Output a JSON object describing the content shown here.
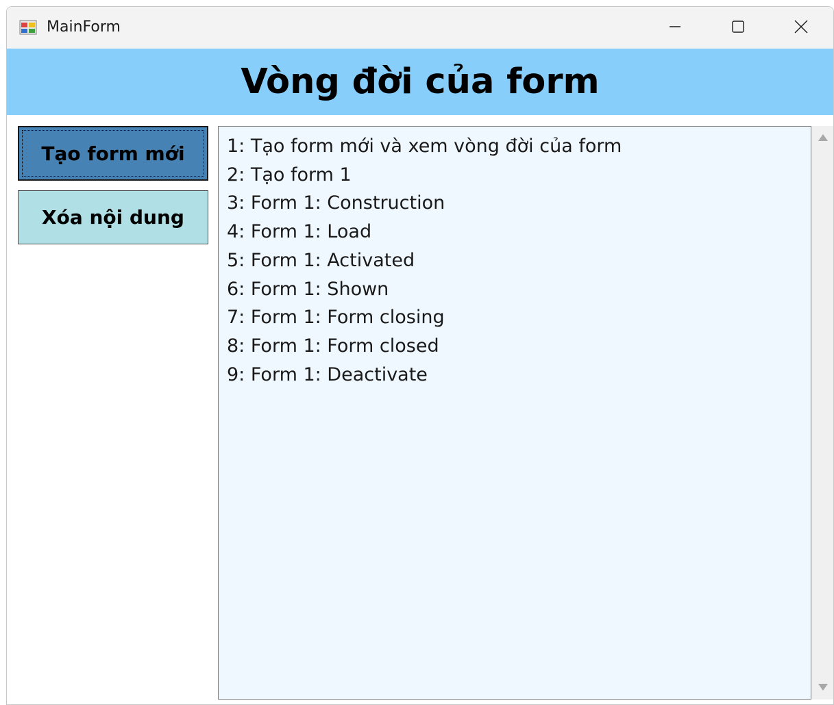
{
  "window": {
    "title": "MainForm"
  },
  "header": {
    "title": "Vòng đời của form"
  },
  "buttons": {
    "create": "Tạo form mới",
    "clear": "Xóa nội dung"
  },
  "log": {
    "items": [
      "1: Tạo form mới và xem vòng đời của form",
      "2: Tạo form 1",
      "3: Form 1: Construction",
      "4: Form 1: Load",
      "5: Form 1: Activated",
      "6: Form 1: Shown",
      "7: Form 1: Form closing",
      "8: Form 1: Form closed",
      "9: Form 1: Deactivate"
    ]
  },
  "colors": {
    "header_bg": "#87cefa",
    "create_button_bg": "#4682b4",
    "clear_button_bg": "#b0e0e6",
    "listbox_bg": "#f0f8ff"
  },
  "icons": {
    "app": "winforms-app-icon",
    "minimize": "minimize-icon",
    "maximize": "maximize-icon",
    "close": "close-icon",
    "scroll_up": "scroll-up-arrow-icon",
    "scroll_down": "scroll-down-arrow-icon"
  }
}
